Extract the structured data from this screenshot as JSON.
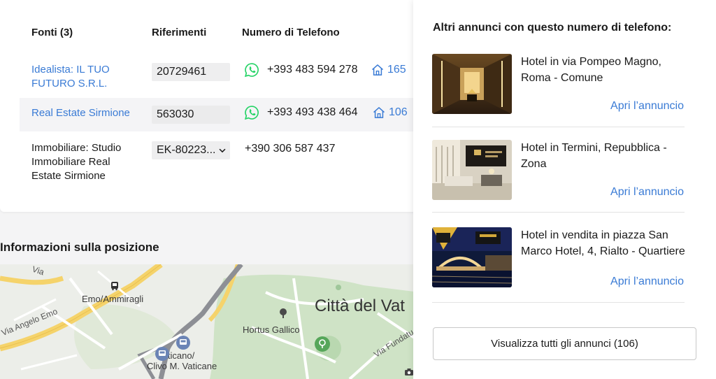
{
  "sources": {
    "headers": {
      "sources": "Fonti (3)",
      "references": "Riferimenti",
      "phone": "Numero di Telefono"
    },
    "rows": [
      {
        "source": "Idealista: IL TUO FUTURO S.R.L.",
        "source_is_link": true,
        "reference": "20729461",
        "phone": "+393 483 594 278",
        "has_whatsapp": true,
        "listings_count": "165"
      },
      {
        "source": "Real Estate Sirmione",
        "source_is_link": true,
        "reference": "563030",
        "phone": "+393 493 438 464",
        "has_whatsapp": true,
        "listings_count": "106"
      },
      {
        "source": "Immobiliare: Studio Immobiliare Real Estate Sirmione",
        "source_is_link": false,
        "reference": "EK-80223...",
        "reference_dropdown": true,
        "phone": "+390 306 587 437",
        "has_whatsapp": false
      }
    ]
  },
  "location": {
    "title": "Informazioni sulla posizione",
    "map_labels": {
      "stop1": "Emo/Ammiragli",
      "stop2": "Vaticano/",
      "stop2b": "Clivo M. Vaticane",
      "garden": "Hortus Gallico",
      "city": "Città del Vat",
      "road1": "Via Angelo Emo",
      "road2": "Via Fundatu",
      "road3": "Via"
    }
  },
  "panel": {
    "title": "Altri annunci con questo numero di telefono:",
    "listings": [
      {
        "title": "Hotel in via Pompeo Magno, Roma - Comune",
        "link": "Apri l’annuncio"
      },
      {
        "title": "Hotel in Termini, Repubblica - Zona",
        "link": "Apri l’annuncio"
      },
      {
        "title": "Hotel in vendita in piazza San Marco Hotel, 4, Rialto - Quartiere",
        "link": "Apri l’annuncio"
      }
    ],
    "view_all": "Visualizza tutti gli annunci (106)"
  },
  "colors": {
    "link": "#3a7bd5",
    "whatsapp": "#25d366",
    "row_alt": "#f4f4f6"
  }
}
